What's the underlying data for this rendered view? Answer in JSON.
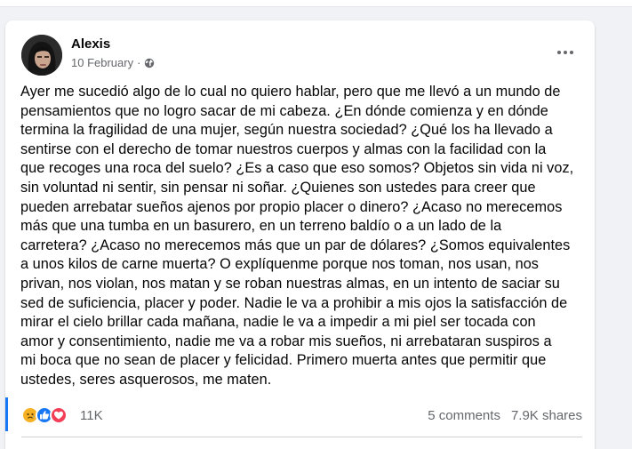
{
  "post": {
    "author": "Alexis",
    "date": "10 February",
    "separator": "·",
    "body": "Ayer me sucedió algo de lo cual no quiero hablar, pero que me llevó a un mundo de\npensamientos que no logro sacar de mi cabeza. ¿En dónde comienza y en dónde\ntermina la fragilidad de una mujer, según nuestra sociedad? ¿Qué los ha llevado a\nsentirse con el derecho de tomar nuestros cuerpos y almas con la facilidad con la\nque recoges una roca del suelo? ¿Es a caso que eso somos? Objetos sin vida ni voz,\nsin voluntad ni sentir, sin pensar ni soñar. ¿Quienes son ustedes para creer que\npueden arrebatar sueños ajenos por propio placer o dinero? ¿Acaso no merecemos\nmás que una tumba en un basurero, en un terreno baldío o a un lado de la\ncarretera? ¿Acaso no merecemos más que un par de dólares? ¿Somos equivalentes\na unos kilos de carne muerta? O explíquenme porque nos toman, nos usan, nos\nprivan, nos violan, nos matan y se roban nuestras almas, en un intento de saciar su\nsed de suficiencia, placer y poder. Nadie le va a prohibir a mis ojos la satisfacción de\nmirar el cielo brillar cada mañana, nadie le va a impedir a mi piel ser tocada con\namor y consentimiento, nadie me va a robar mis sueños, ni arrebataran suspiros a\nmi boca que no sean de placer y felicidad. Primero muerta antes que permitir que\nustedes, seres asquerosos, me maten.",
    "reaction_count": "11K",
    "comments": "5 comments",
    "shares": "7.9K shares",
    "reactions": [
      "sad-reaction-icon",
      "like-reaction-icon",
      "love-reaction-icon"
    ]
  },
  "colors": {
    "accent": "#1877f2",
    "secondary_text": "#65676b",
    "sad": "#f7b125",
    "love": "#f33e58"
  }
}
